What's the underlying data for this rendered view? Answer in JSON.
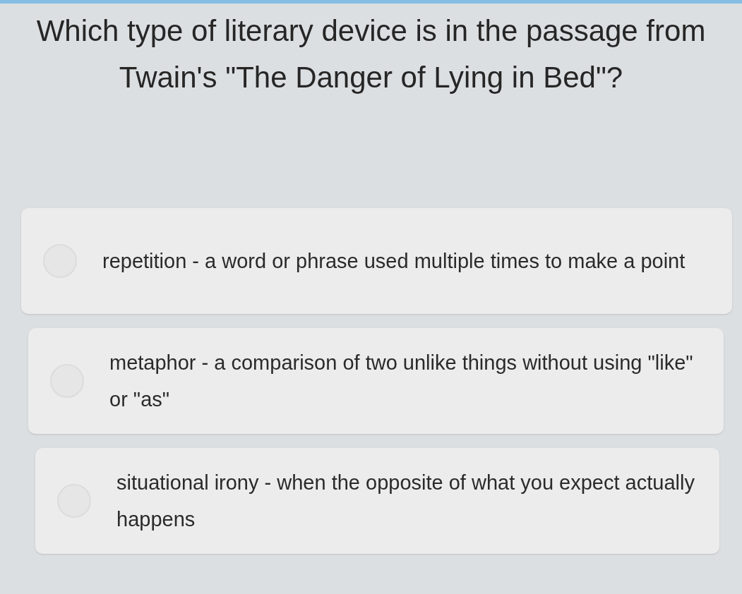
{
  "question": "Which type of literary device is in the passage from Twain's \"The Danger of Lying in Bed\"?",
  "options": [
    {
      "text": "repetition - a word or phrase used multiple times to make a point",
      "selected": false
    },
    {
      "text": "metaphor - a comparison of two unlike things without using \"like\" or \"as\"",
      "selected": false
    },
    {
      "text": "situational irony - when the opposite of what you expect actually happens",
      "selected": false
    }
  ]
}
